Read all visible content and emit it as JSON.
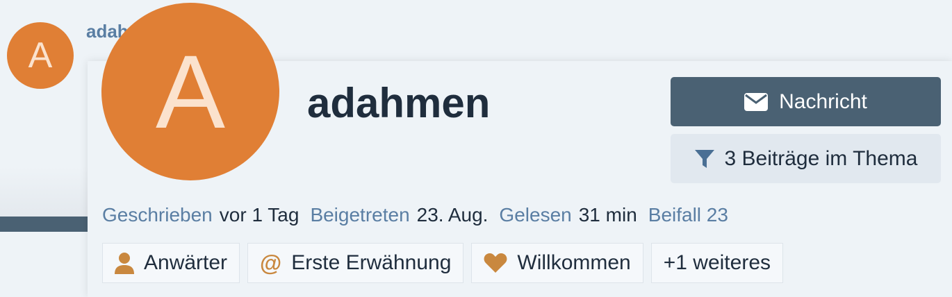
{
  "background_post": {
    "avatar_letter": "A",
    "username_partial": "adahmen"
  },
  "card": {
    "avatar_letter": "A",
    "username": "adahmen",
    "message_button": "Nachricht",
    "posts_button": "3 Beiträge im Thema",
    "meta": {
      "written_label": "Geschrieben",
      "written_value": "vor 1 Tag",
      "joined_label": "Beigetreten",
      "joined_value": "23. Aug.",
      "read_label": "Gelesen",
      "read_value": "31 min",
      "applause": "Beifall 23"
    },
    "badges": [
      {
        "label": "Anwärter",
        "icon": "user-icon"
      },
      {
        "label": "Erste Erwähnung",
        "icon": "at-icon"
      },
      {
        "label": "Willkommen",
        "icon": "heart-icon"
      },
      {
        "label": "+1 weiteres"
      }
    ]
  },
  "colors": {
    "avatar": "#e07f35",
    "primary_button": "#4a6173",
    "link": "#5a7ea3",
    "badge_icon": "#c9883f"
  }
}
